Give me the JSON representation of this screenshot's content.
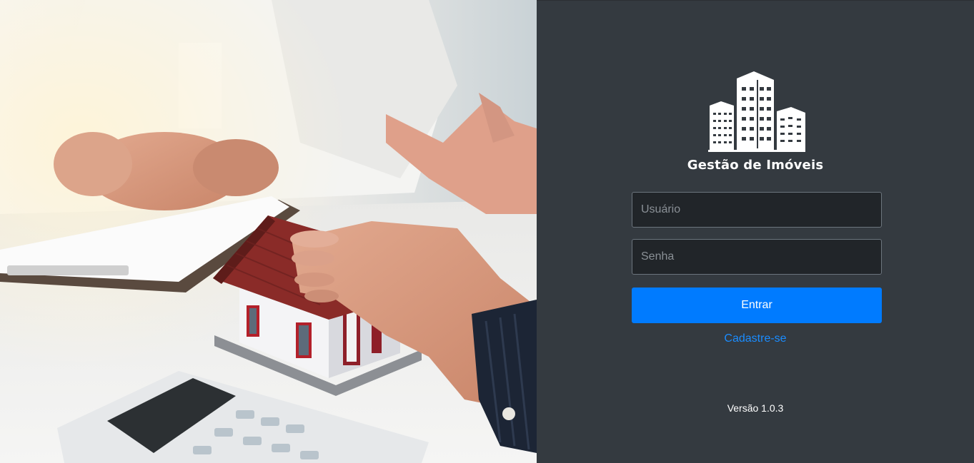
{
  "hero_image": {
    "icon": "real-estate-handshake-photo",
    "description_icon": "house-model-calculator-icon"
  },
  "brand": {
    "logo_icon": "buildings-logo-icon",
    "name": "Gestão de Imóveis"
  },
  "login_form": {
    "username_placeholder": "Usuário",
    "username_value": "",
    "password_placeholder": "Senha",
    "password_value": "",
    "submit_label": "Entrar",
    "signup_label": "Cadastre-se"
  },
  "footer": {
    "version": "Versão 1.0.3"
  },
  "colors": {
    "panel_bg": "#343a40",
    "input_bg": "#212529",
    "primary": "#007bff",
    "link": "#1a8cff"
  }
}
